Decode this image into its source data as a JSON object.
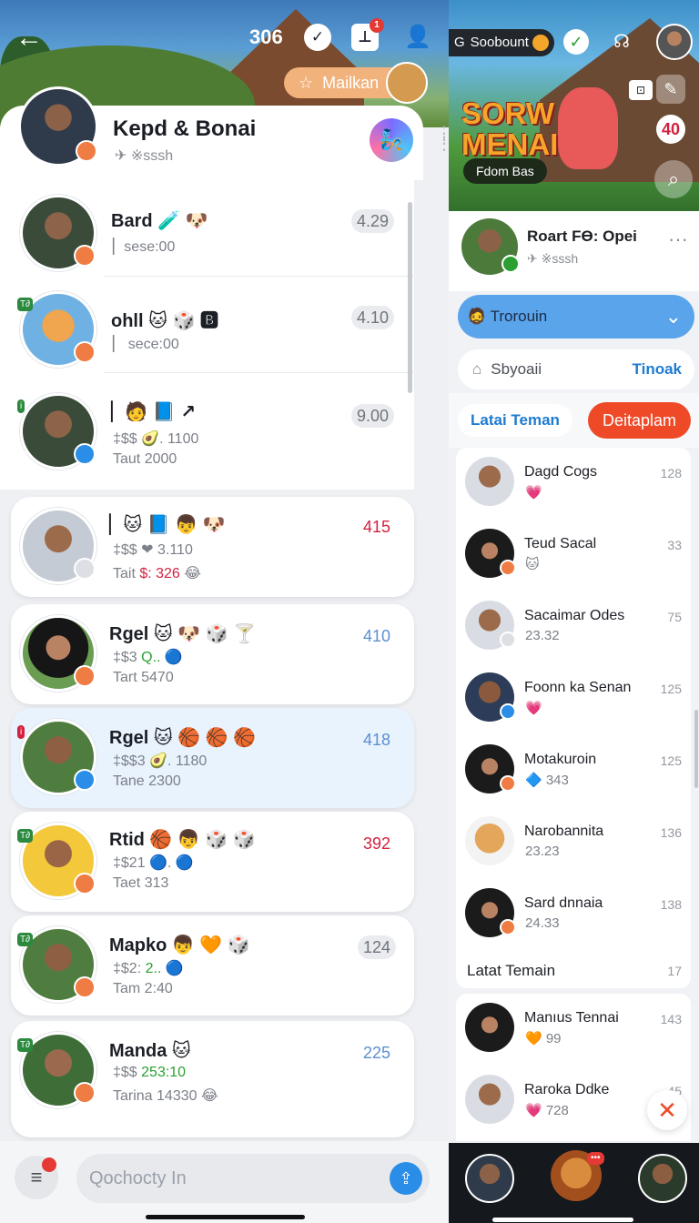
{
  "left": {
    "top_count": "306",
    "mailkan_label": "Mailkan",
    "header": {
      "name": "Kepd & Bonai",
      "sub": "✈ ※sssh"
    },
    "rows": [
      {
        "name": "Bard 🧪 🐶",
        "sub": "▏sese:00",
        "num": "4.29"
      },
      {
        "name": "ohll 🐱 🎲 🅱",
        "sub": "▏ sece:00",
        "num": "4.10"
      },
      {
        "name": "▏🧑 📘 ↗",
        "sub1": "‡$$ 🥑. 1100",
        "sub2": "Taut 2000",
        "num": "9.00"
      }
    ],
    "cards": [
      {
        "name": "▏🐱 📘 👦 🐶",
        "sub1_a": "‡$$ ❤ 3.110",
        "sub2_a": "Tait ",
        "sub2_b": "$: 326",
        "sub2_c": " 😂",
        "num": "415"
      },
      {
        "name": "Rgel 🐱 🐶 🎲 🍸",
        "sub1_a": "‡$3 ",
        "sub1_b": "Q..",
        "sub1_c": " 🔵",
        "sub2_a": "Tart 5470",
        "num": "410"
      },
      {
        "name": "Rgel 🐱 🏀 🏀 🏀",
        "sub1_a": "‡$$3 🥑. 1180",
        "sub2_a": "Tane 2300",
        "num": "418"
      },
      {
        "name": "Rtid 🏀 👦 🎲 🎲",
        "sub1_a": "‡$21 🔵. 🔵",
        "sub2_a": "Taet 313",
        "num": "392"
      },
      {
        "name": "Mapko 👦 🧡 🎲",
        "sub1_a": "‡$2: ",
        "sub1_b": "2..",
        "sub1_c": " 🔵",
        "sub2_a": "Tam 2:40",
        "num": "124"
      },
      {
        "name": "Manda 🐱",
        "sub1_a": "‡$$ ",
        "sub1_b": "253:10",
        "sub1_c": "",
        "sub2_a": "Tarina 14330 😂",
        "num": "225"
      }
    ],
    "search_placeholder": "Qochocty In"
  },
  "right": {
    "pill_label": "Soobount",
    "game_title": "SORW\nMENAI",
    "from_label": "Fdom Bas",
    "badge_num": "40",
    "profile": {
      "name": "Roart FӨ: Opei",
      "sub": "✈ ※sssh"
    },
    "select_label": "🧔 Trorouin",
    "input_label": "Sbyoaii",
    "input_link": "Tinoak",
    "tab1": "Latai Teman",
    "tab2": "Deitaplam",
    "list": [
      {
        "name": "Dagd Cogs",
        "sub": "💗",
        "num": "128"
      },
      {
        "name": "Teud Sacal",
        "sub": "🐱",
        "num": "33"
      },
      {
        "name": "Sacaimar Odes",
        "sub": "23.32",
        "num": "75"
      },
      {
        "name": "Foonn ka Senan",
        "sub": "💗",
        "num": "125"
      },
      {
        "name": "Motakuroin",
        "sub": "🔷 343",
        "num": "125"
      },
      {
        "name": "Narobannita",
        "sub": "23.23",
        "num": "136"
      },
      {
        "name": "Sard dnnaia",
        "sub": "24.33",
        "num": "138"
      }
    ],
    "section": {
      "title": "Latat Temain",
      "count": "17"
    },
    "list2": [
      {
        "name": "Manıus Tennai",
        "sub": "🧡 99",
        "num": "143"
      },
      {
        "name": "Raroka Ddke",
        "sub": "💗 728",
        "num": "45"
      }
    ]
  }
}
